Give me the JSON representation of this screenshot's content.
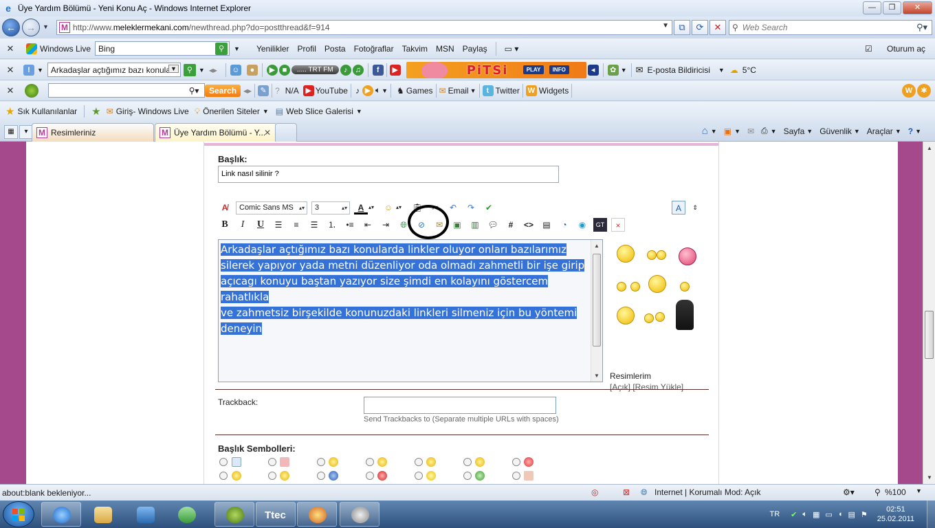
{
  "window": {
    "title": "Üye Yardım Bölümü - Yeni Konu Aç - Windows Internet Explorer",
    "min": "—",
    "max": "❐",
    "close": "✕"
  },
  "address_bar": {
    "url_prefix": "http://www.",
    "url_domain": "meleklermekani.com",
    "url_path": "/newthread.php?do=postthread&f=914",
    "search_placeholder": "Web Search"
  },
  "toolbar_live": {
    "brand": "Windows Live",
    "search_value": "Bing",
    "items": [
      "Yenilikler",
      "Profil",
      "Posta",
      "Fotoğraflar",
      "Takvim",
      "MSN",
      "Paylaş"
    ],
    "signin": "Oturum aç"
  },
  "toolbar_radio": {
    "dropdown_value": "Arkadaşlar açtığımız bazı konular",
    "radio": "..... TRT FM",
    "banner": "PiTSi",
    "banner_play": "PLAY",
    "banner_info": "INFO",
    "email_notifier": "E-posta Bildiricisi",
    "weather": "5°C"
  },
  "toolbar_third": {
    "search_button": "Search",
    "na": "N/A",
    "youtube": "YouTube",
    "games": "Games",
    "email": "Email",
    "twitter": "Twitter",
    "widgets": "Widgets"
  },
  "favorites": {
    "label": "Sık Kullanılanlar",
    "items": [
      "Giriş- Windows Live",
      "Önerilen Siteler",
      "Web Slice Galerisi"
    ]
  },
  "tabs": [
    {
      "label": "Resimleriniz"
    },
    {
      "label": "Üye Yardım Bölümü - Y..."
    }
  ],
  "command_bar": {
    "page": "Sayfa",
    "safety": "Güvenlik",
    "tools": "Araçlar"
  },
  "form": {
    "title_label": "Başlık:",
    "title_value": "Link nasıl silinir ?",
    "font_family": "Comic Sans MS",
    "font_size": "3",
    "body_lines": [
      "Arkadaşlar açtığımız bazı konularda linkler oluyor onları bazılarımız",
      "silerek yapıyor yada metni düzenliyor oda olmadı zahmetli bir işe girip",
      "açıcagı konuyu baştan yazıyor size şimdi en kolayını göstercem rahatlıkla",
      "ve zahmetsiz birşekilde konunuzdaki linkleri silmeniz için bu yöntemi",
      "deneyin"
    ],
    "images_label": "Resimlerim",
    "images_links": "[Açık] [Resim Yükle]",
    "trackback_label": "Trackback:",
    "trackback_note": "Send Trackbacks to (Separate multiple URLs with spaces)",
    "icons_label": "Başlık Sembolleri:"
  },
  "status_bar": {
    "text": "about:blank bekleniyor...",
    "zone": "Internet | Korumalı Mod: Açık",
    "zoom": "%100"
  },
  "taskbar": {
    "tray_lang": "TR",
    "time": "02:51",
    "date": "25.02.2011",
    "app_label": "Ttec"
  }
}
